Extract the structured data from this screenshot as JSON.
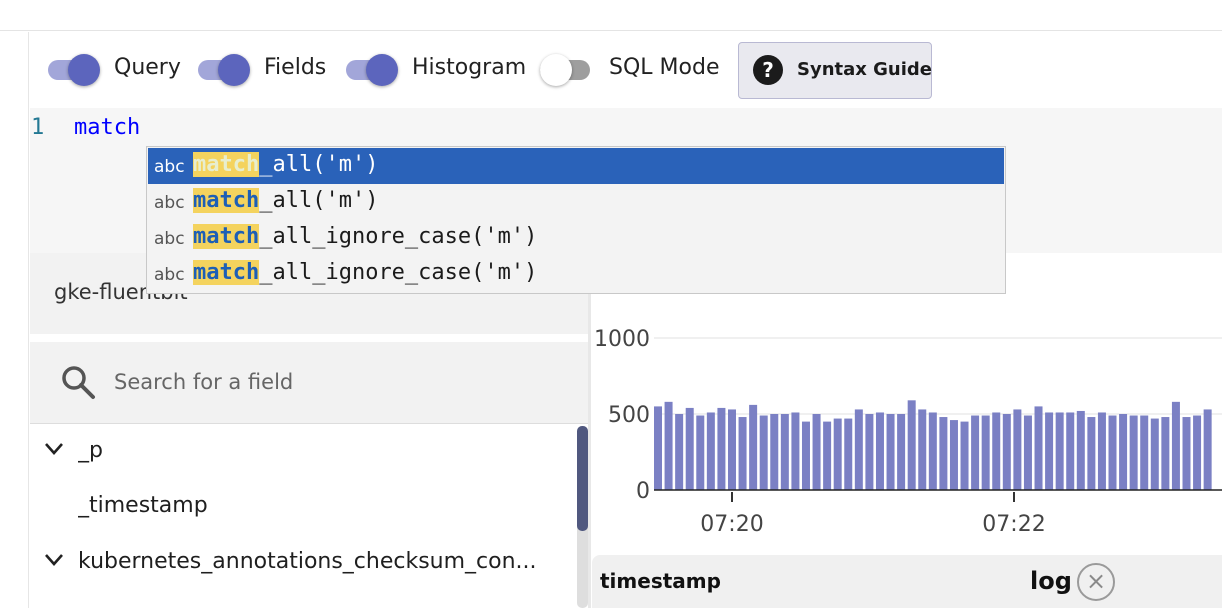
{
  "toolbar": {
    "toggles": [
      {
        "label": "Query",
        "on": true
      },
      {
        "label": "Fields",
        "on": true
      },
      {
        "label": "Histogram",
        "on": true
      },
      {
        "label": "SQL Mode",
        "on": false
      }
    ],
    "syntax_guide": {
      "icon": "question-icon",
      "glyph": "?",
      "label": "Syntax Guide"
    }
  },
  "editor": {
    "line_number": "1",
    "code": "match"
  },
  "suggestions": {
    "icon_label": "abc",
    "match_prefix": "match",
    "items": [
      {
        "prefix": "match",
        "rest": "_all('m')",
        "selected": true
      },
      {
        "prefix": "match",
        "rest": "_all('m')",
        "selected": false
      },
      {
        "prefix": "match",
        "rest": "_all_ignore_case('m')",
        "selected": false
      },
      {
        "prefix": "match",
        "rest": "_all_ignore_case('m')",
        "selected": false
      }
    ]
  },
  "stream_selector": {
    "value": "gke-fluentbit"
  },
  "field_search": {
    "placeholder": "Search for a field",
    "icon": "search-icon"
  },
  "fields": [
    {
      "label": "_p",
      "expandable": true
    },
    {
      "label": "_timestamp",
      "expandable": false
    },
    {
      "label": "kubernetes_annotations_checksum_con...",
      "expandable": true
    }
  ],
  "colors": {
    "accent": "#5c65bd",
    "bar": "#7b80c4",
    "selection": "#2a62b9",
    "highlight": "#f4d35e"
  },
  "chart_data": {
    "type": "bar",
    "ylim": [
      0,
      1000
    ],
    "yticks": [
      "0",
      "500",
      "1000"
    ],
    "xticks": [
      "07:20",
      "07:22"
    ],
    "values": [
      550,
      580,
      500,
      540,
      490,
      510,
      540,
      530,
      480,
      560,
      490,
      500,
      500,
      510,
      450,
      500,
      450,
      470,
      470,
      530,
      500,
      510,
      500,
      500,
      590,
      530,
      510,
      480,
      460,
      450,
      490,
      490,
      510,
      500,
      530,
      490,
      550,
      510,
      510,
      510,
      520,
      480,
      510,
      490,
      500,
      490,
      490,
      470,
      480,
      580,
      480,
      490,
      530,
      510
    ]
  },
  "table": {
    "col_timestamp": "timestamp",
    "col_log": "log",
    "close_glyph": "×"
  }
}
